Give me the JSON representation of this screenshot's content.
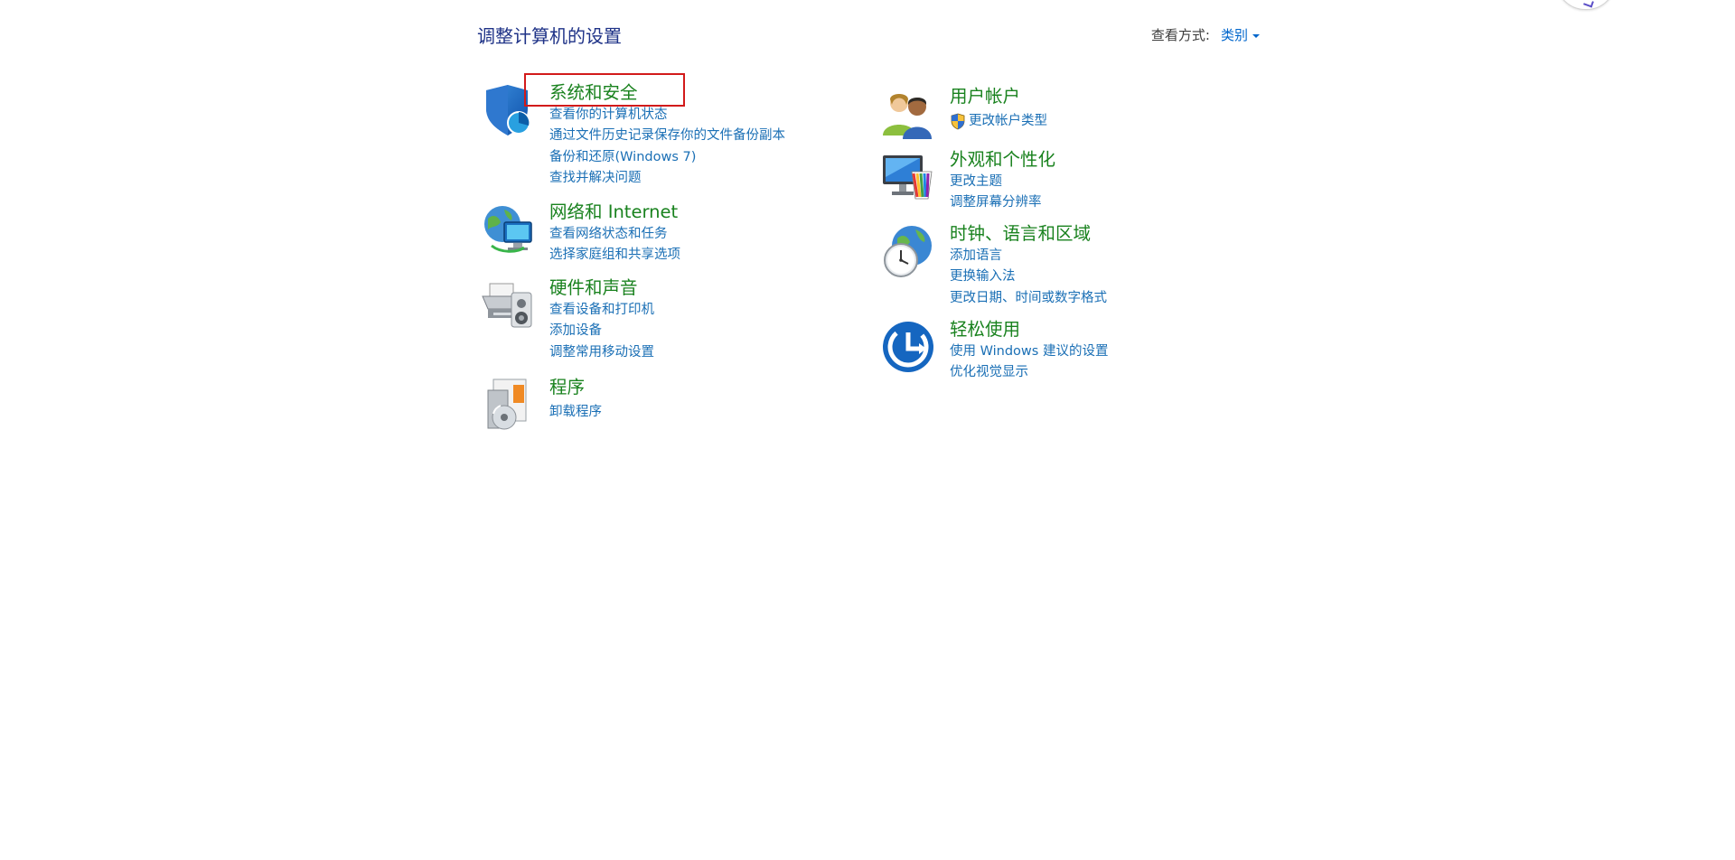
{
  "header": {
    "title": "调整计算机的设置",
    "view_by_label": "查看方式:",
    "view_by_value": "类别"
  },
  "categories_left": [
    {
      "title": "系统和安全",
      "icon": "system-security-shield-icon",
      "links": [
        "查看你的计算机状态",
        "通过文件历史记录保存你的文件备份副本",
        "备份和还原(Windows 7)",
        "查找并解决问题"
      ]
    },
    {
      "title": "网络和 Internet",
      "icon": "network-globe-icon",
      "links": [
        "查看网络状态和任务",
        "选择家庭组和共享选项"
      ]
    },
    {
      "title": "硬件和声音",
      "icon": "printer-speaker-icon",
      "links": [
        "查看设备和打印机",
        "添加设备",
        "调整常用移动设置"
      ]
    },
    {
      "title": "程序",
      "icon": "programs-disc-icon",
      "links": [
        "卸载程序"
      ]
    }
  ],
  "categories_right": [
    {
      "title": "用户帐户",
      "icon": "user-accounts-icon",
      "links": [
        "更改帐户类型"
      ]
    },
    {
      "title": "外观和个性化",
      "icon": "appearance-monitor-icon",
      "links": [
        "更改主题",
        "调整屏幕分辨率"
      ]
    },
    {
      "title": "时钟、语言和区域",
      "icon": "clock-globe-icon",
      "links": [
        "添加语言",
        "更换输入法",
        "更改日期、时间或数字格式"
      ]
    },
    {
      "title": "轻松使用",
      "icon": "ease-of-access-icon",
      "links": [
        "使用 Windows 建议的设置",
        "优化视觉显示"
      ]
    }
  ],
  "colors": {
    "title_blue": "#1e3287",
    "category_green": "#19821e",
    "link_blue": "#1a6fb5",
    "highlight_red": "#d21a1a"
  }
}
